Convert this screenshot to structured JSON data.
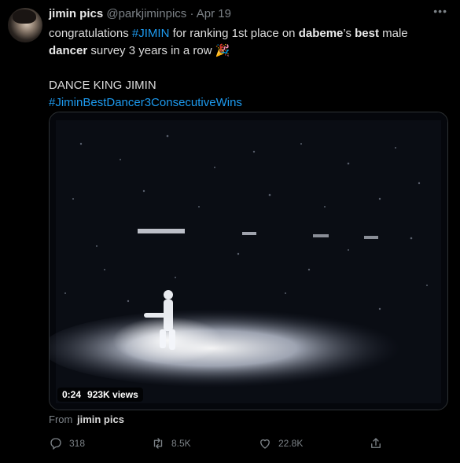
{
  "tweet": {
    "name": "jimin pics",
    "handle": "@parkjiminpics",
    "separator": "·",
    "date": "Apr 19",
    "more": "•••",
    "line1_a": "congratulations ",
    "line1_hashtag": "#JIMIN",
    "line1_b": " for ranking 1st place on ",
    "line1_bold1": "dabeme",
    "line1_c": "’s ",
    "line1_bold2": "best",
    "line1_d": " male",
    "line2_bold": "dancer",
    "line2_a": " survey 3 years in a row ",
    "line2_emoji": "🎉",
    "line3": "DANCE KING JIMIN",
    "line4_hashtag": "#JiminBestDancer3ConsecutiveWins"
  },
  "media": {
    "duration": "0:24",
    "views": "923K views"
  },
  "source": {
    "prefix": "From",
    "name": "jimin pics"
  },
  "actions": {
    "replies": "318",
    "retweets": "8.5K",
    "likes": "22.8K"
  },
  "icons": {
    "avatar": "avatar",
    "more": "more-icon",
    "reply": "reply-icon",
    "retweet": "retweet-icon",
    "like": "heart-icon",
    "share": "share-icon"
  }
}
